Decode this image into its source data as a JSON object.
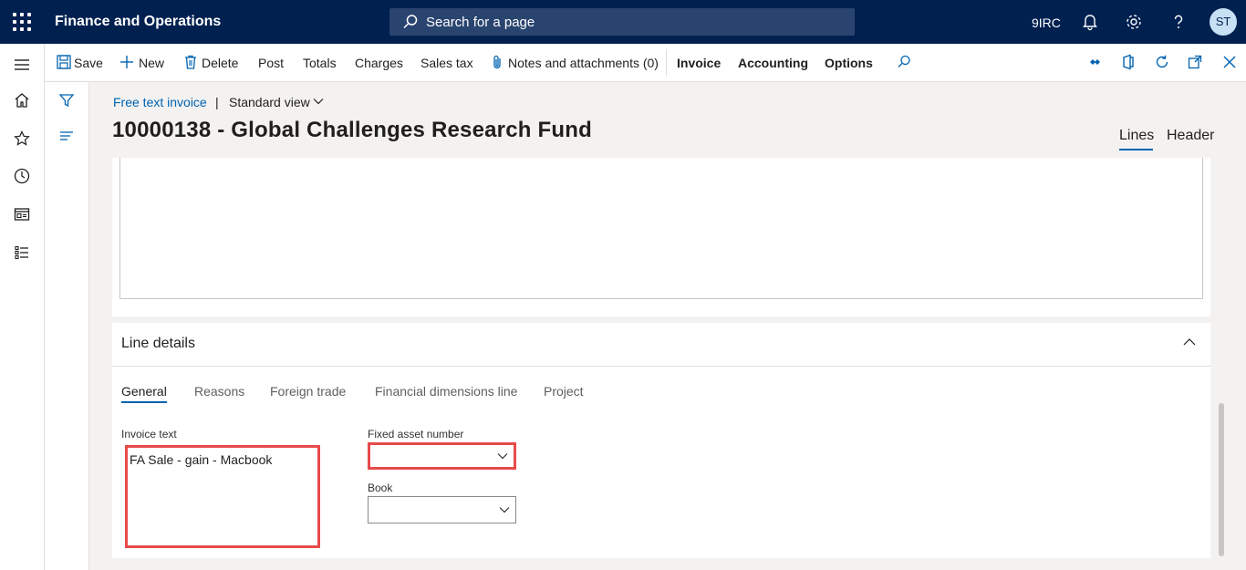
{
  "topbar": {
    "app_title": "Finance and Operations",
    "search_placeholder": "Search for a page",
    "company": "9IRC",
    "user_initials": "ST"
  },
  "actions": {
    "save": "Save",
    "new": "New",
    "delete": "Delete",
    "post": "Post",
    "totals": "Totals",
    "charges": "Charges",
    "sales_tax": "Sales tax",
    "notes": "Notes and attachments (0)",
    "invoice": "Invoice",
    "accounting": "Accounting",
    "options": "Options"
  },
  "breadcrumb": {
    "form": "Free text invoice",
    "separator": "|",
    "view": "Standard view"
  },
  "page_title": "10000138 - Global Challenges Research Fund",
  "view_tabs": {
    "lines": "Lines",
    "header": "Header"
  },
  "line_details": {
    "title": "Line details",
    "tabs": [
      "General",
      "Reasons",
      "Foreign trade",
      "Financial dimensions line",
      "Project"
    ],
    "invoice_text_label": "Invoice text",
    "invoice_text_value": "FA Sale - gain - Macbook",
    "fixed_asset_label": "Fixed asset number",
    "fixed_asset_value": "",
    "book_label": "Book",
    "book_value": ""
  },
  "colors": {
    "nav_bg": "#002050",
    "accent": "#0063b1",
    "highlight": "#e84a4a"
  }
}
